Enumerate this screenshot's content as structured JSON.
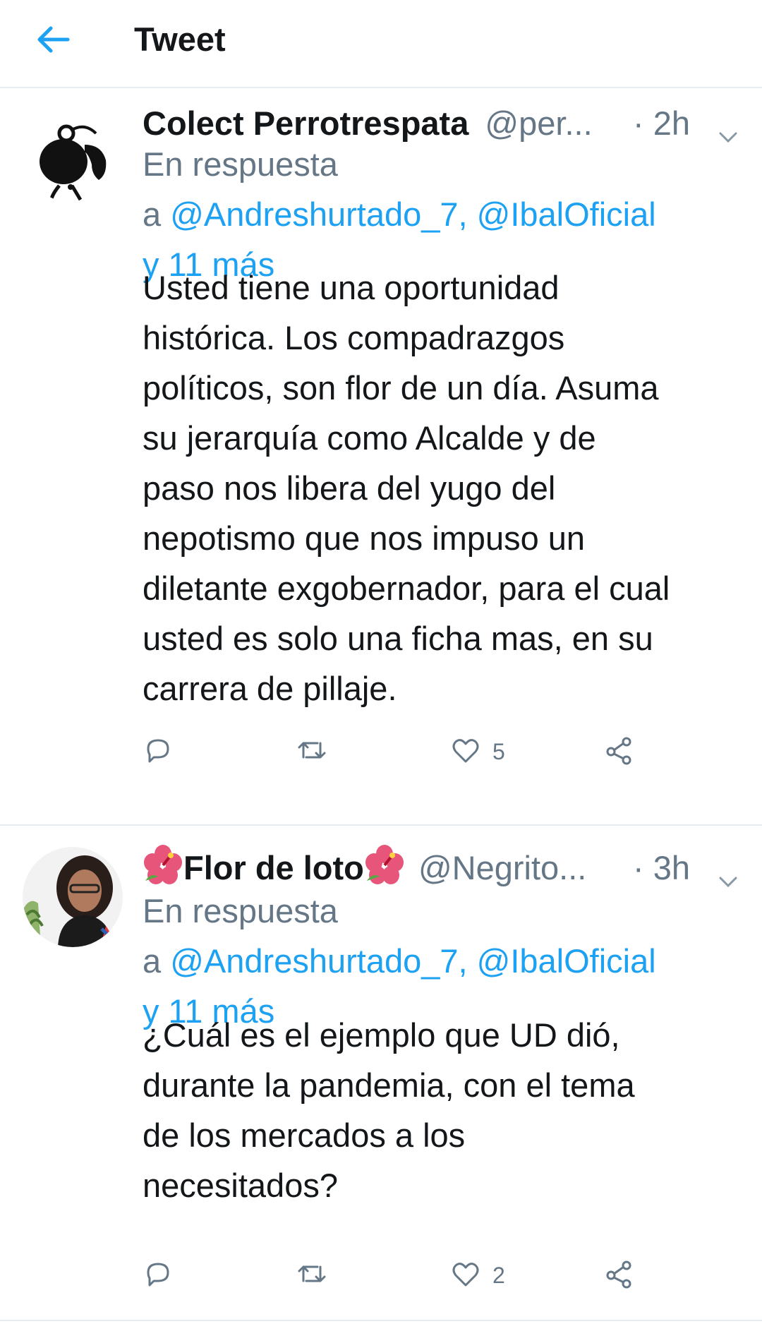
{
  "header": {
    "title": "Tweet"
  },
  "colors": {
    "accent": "#1da1f2",
    "muted": "#657786",
    "text": "#14171a",
    "divider": "#e6ecf0"
  },
  "tweets": [
    {
      "display_name": "Colect Perrotrespata",
      "handle": "@per...",
      "time": "· 2h",
      "reply_prefix": "En respuesta",
      "reply_a": "a",
      "reply_links": "@Andreshurtado_7, @IbalOficial",
      "reply_more": "y 11 más",
      "text_lines": [
        "Usted tiene una oportunidad",
        "histórica. Los compadrazgos",
        "políticos, son flor de un día. Asuma",
        "su jerarquía como Alcalde y de",
        "paso nos libera del yugo del",
        "nepotismo que nos impuso un",
        "diletante exgobernador, para el cual",
        "usted es solo una ficha mas, en su",
        "carrera de pillaje."
      ],
      "likes": "5"
    },
    {
      "display_name": "Flor de loto",
      "handle": "@Negrito...",
      "time": "· 3h",
      "reply_prefix": "En respuesta",
      "reply_a": "a",
      "reply_links": "@Andreshurtado_7, @IbalOficial",
      "reply_more": "y 11 más",
      "text_lines": [
        "¿Cuál es el ejemplo que UD dió,",
        "durante la pandemia, con el tema",
        "de los mercados a los",
        "necesitados?"
      ],
      "likes": "2"
    }
  ]
}
